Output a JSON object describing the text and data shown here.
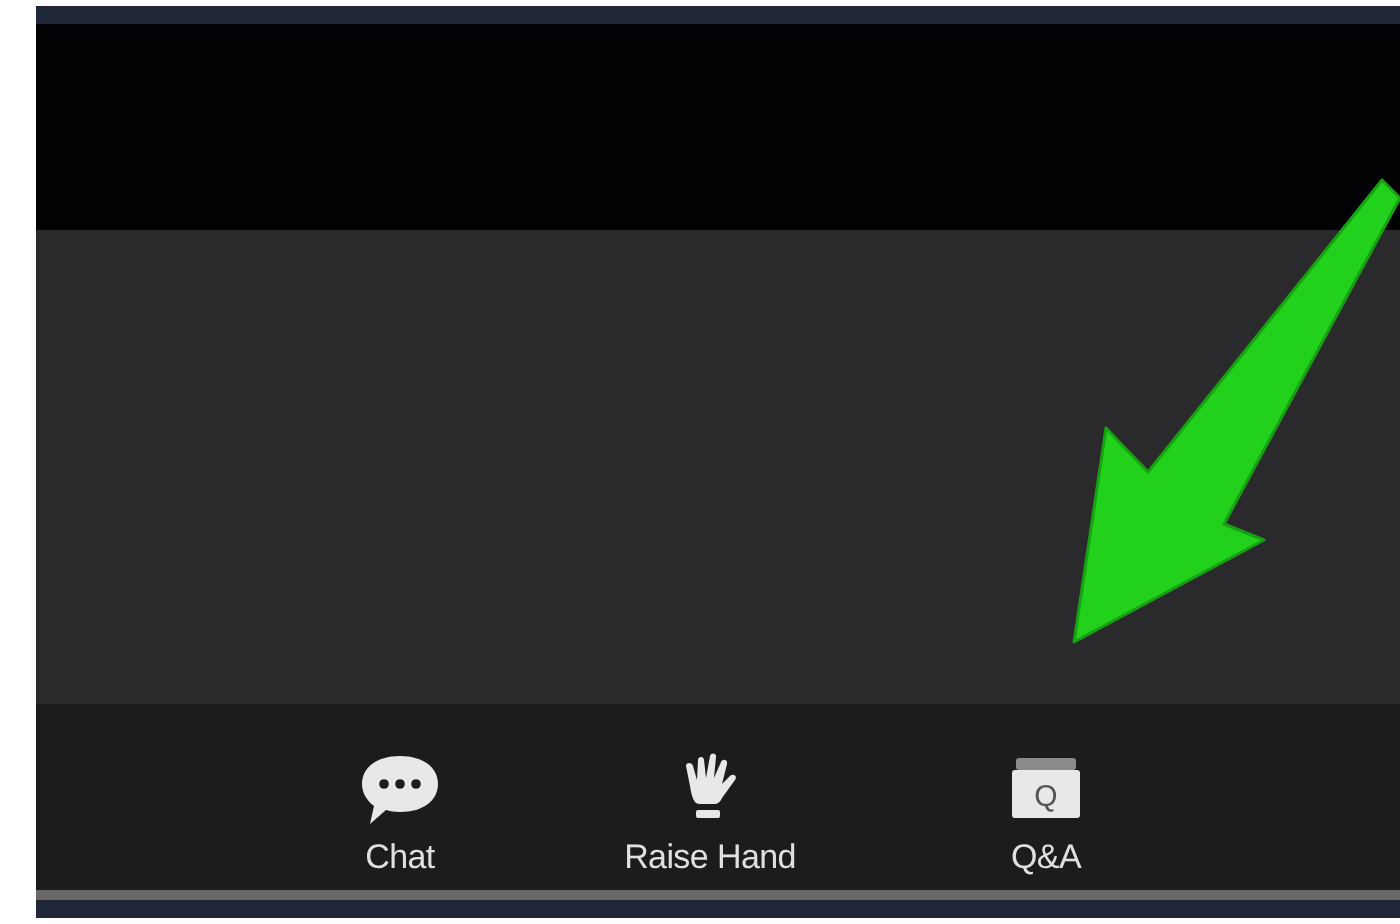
{
  "toolbar": {
    "buttons": [
      {
        "kind": "chat",
        "label": "Chat"
      },
      {
        "kind": "hand",
        "label": "Raise Hand"
      },
      {
        "kind": "qa",
        "label": "Q&A",
        "icon_letter": "Q"
      }
    ]
  }
}
